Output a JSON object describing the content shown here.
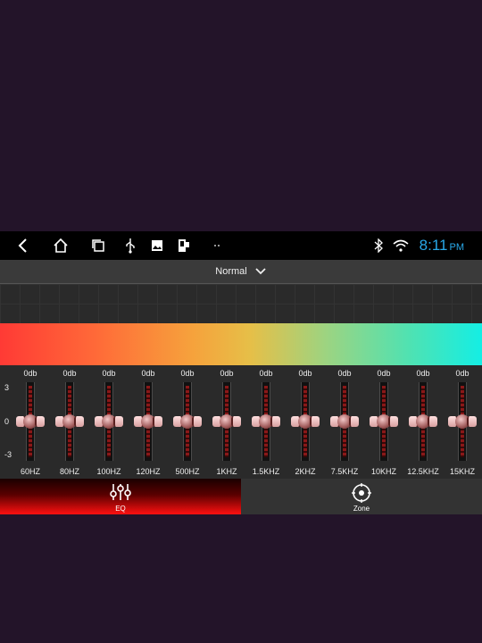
{
  "status_bar": {
    "nav_icons": [
      "back-icon",
      "home-icon",
      "recents-icon",
      "usb-icon",
      "image-icon",
      "device-icon",
      "dots-icon"
    ],
    "status_icons": [
      "bluetooth-icon",
      "wifi-icon"
    ],
    "time": "8:11",
    "ampm": "PM",
    "time_color": "#29a8e8"
  },
  "preset": {
    "label": "Normal",
    "icon": "chevron-down-icon"
  },
  "eq": {
    "scale": {
      "max": "3",
      "mid": "0",
      "min": "-3"
    },
    "bands": [
      {
        "freq": "60HZ",
        "db": "0db",
        "value": 0
      },
      {
        "freq": "80HZ",
        "db": "0db",
        "value": 0
      },
      {
        "freq": "100HZ",
        "db": "0db",
        "value": 0
      },
      {
        "freq": "120HZ",
        "db": "0db",
        "value": 0
      },
      {
        "freq": "500HZ",
        "db": "0db",
        "value": 0
      },
      {
        "freq": "1KHZ",
        "db": "0db",
        "value": 0
      },
      {
        "freq": "1.5KHZ",
        "db": "0db",
        "value": 0
      },
      {
        "freq": "2KHZ",
        "db": "0db",
        "value": 0
      },
      {
        "freq": "7.5KHZ",
        "db": "0db",
        "value": 0
      },
      {
        "freq": "10KHZ",
        "db": "0db",
        "value": 0
      },
      {
        "freq": "12.5KHZ",
        "db": "0db",
        "value": 0
      },
      {
        "freq": "15KHZ",
        "db": "0db",
        "value": 0
      }
    ]
  },
  "tabs": [
    {
      "label": "EQ",
      "icon": "equalizer-icon",
      "active": true
    },
    {
      "label": "Zone",
      "icon": "zone-target-icon",
      "active": false
    }
  ],
  "colors": {
    "accent_red": "#ff1010",
    "spectrum": [
      "#ff3a35",
      "#f6a23c",
      "#14eee4"
    ]
  }
}
